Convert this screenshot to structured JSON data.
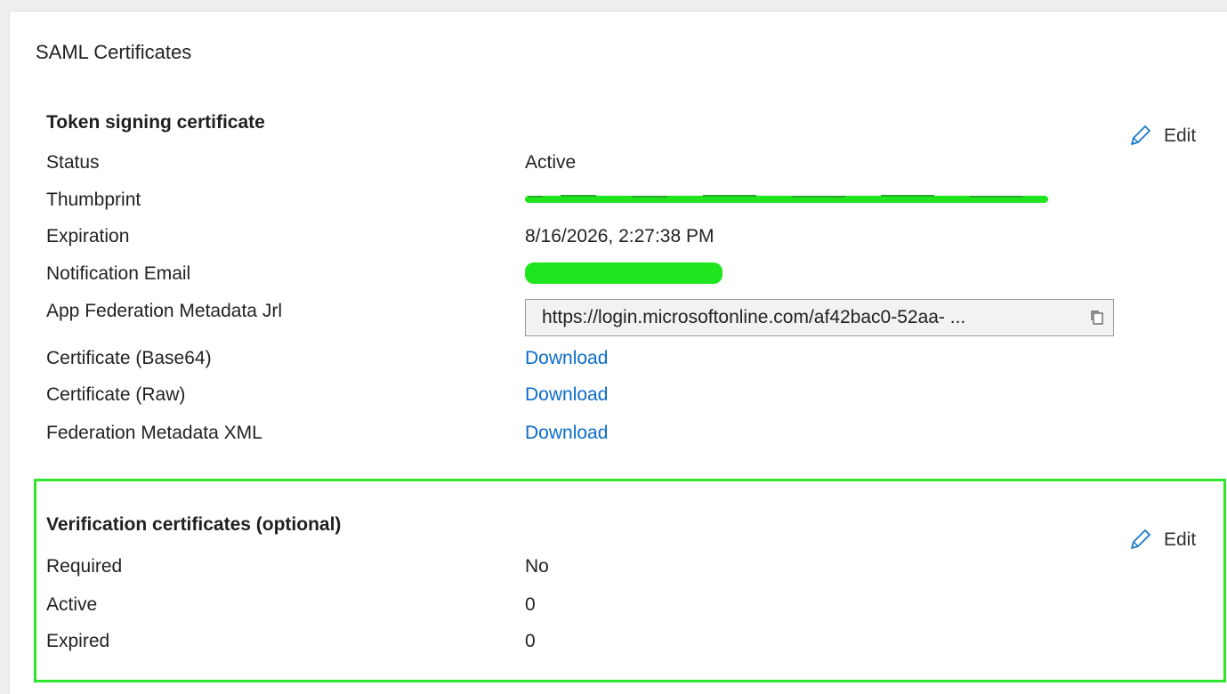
{
  "title": "SAML Certificates",
  "token_section": {
    "heading": "Token signing certificate",
    "edit_label": "Edit",
    "rows": {
      "status": {
        "label": "Status",
        "value": "Active"
      },
      "thumbprint": {
        "label": "Thumbprint"
      },
      "expiration": {
        "label": "Expiration",
        "value": "8/16/2026, 2:27:38 PM"
      },
      "notification_email": {
        "label": "Notification Email"
      },
      "metadata_url": {
        "label": "App Federation Metadata Jrl",
        "value": "https://login.microsoftonline.com/af42bac0-52aa- ..."
      },
      "cert_base64": {
        "label": "Certificate (Base64)",
        "link": "Download"
      },
      "cert_raw": {
        "label": "Certificate (Raw)",
        "link": "Download"
      },
      "federation_xml": {
        "label": "Federation Metadata XML",
        "link": "Download"
      }
    }
  },
  "verification_section": {
    "heading": "Verification certificates (optional)",
    "edit_label": "Edit",
    "rows": {
      "required": {
        "label": "Required",
        "value": "No"
      },
      "active": {
        "label": "Active",
        "value": "0"
      },
      "expired": {
        "label": "Expired",
        "value": "0"
      }
    }
  },
  "colors": {
    "link": "#0b6cc9",
    "highlight": "#2ee62e",
    "redaction": "#1ee51e"
  },
  "icons": {
    "edit": "pencil-icon",
    "copy": "copy-icon"
  }
}
